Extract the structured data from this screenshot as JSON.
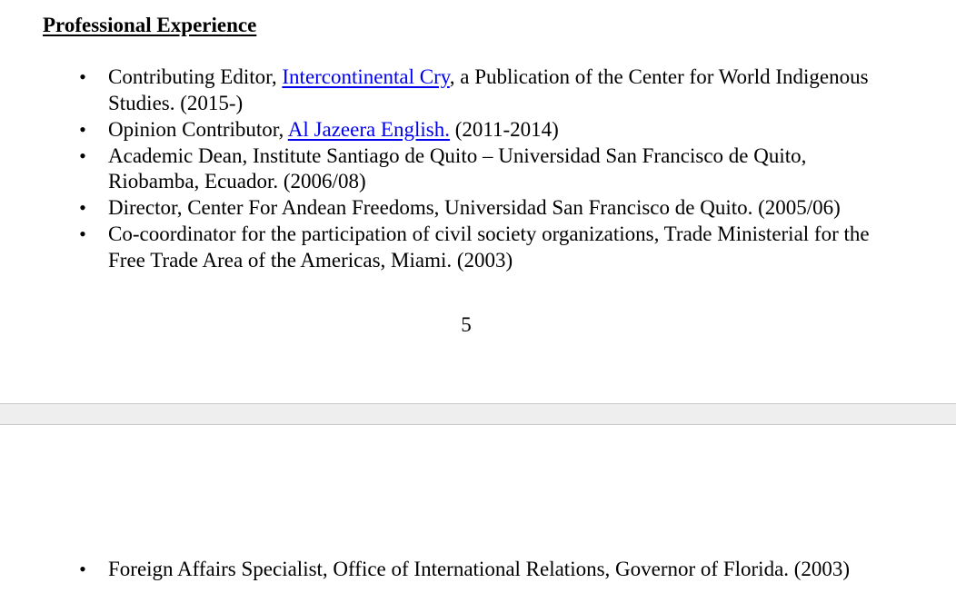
{
  "section": {
    "title": "Professional Experience"
  },
  "experience_page1": [
    {
      "before": "Contributing Editor, ",
      "link": "Intercontinental Cry",
      "after": ", a Publication of the Center for World Indigenous Studies. (2015-)"
    },
    {
      "before": "Opinion Contributor, ",
      "link": "Al Jazeera English.",
      "after": " (2011-2014)"
    },
    {
      "text": "Academic Dean, Institute Santiago de Quito – Universidad San Francisco de Quito, Riobamba, Ecuador. (2006/08)"
    },
    {
      "text": "Director, Center For Andean Freedoms, Universidad San Francisco de Quito. (2005/06)"
    },
    {
      "text": "Co-coordinator for the participation of civil society organizations, Trade Ministerial for the Free Trade Area of the Americas, Miami. (2003)"
    }
  ],
  "page_number": "5",
  "experience_page2": [
    {
      "text": "Foreign Affairs Specialist, Office of International Relations, Governor of Florida. (2003)"
    }
  ],
  "bullet_glyph": "•",
  "colors": {
    "link": "#0000ee",
    "page_gap": "#eeeeee"
  }
}
